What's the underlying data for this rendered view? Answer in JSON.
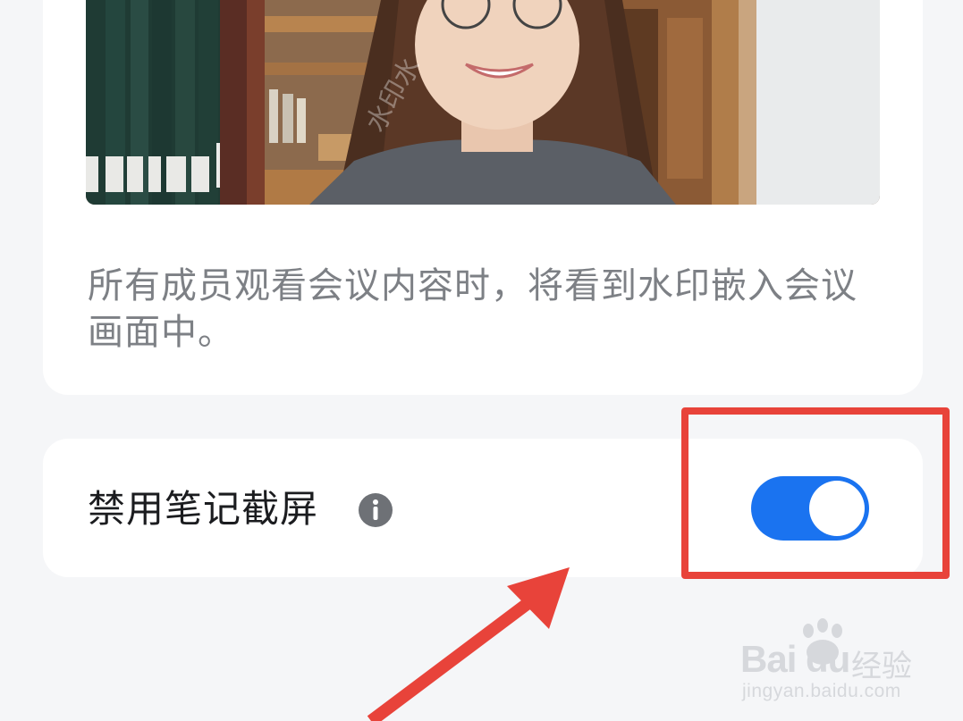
{
  "watermark_section": {
    "description": "所有成员观看会议内容时，将看到水印嵌入会议画面中。",
    "preview_watermark_text": "水印水"
  },
  "screenshot_setting": {
    "label": "禁用笔记截屏",
    "info_icon": "info-circle-icon",
    "toggle_state": "on",
    "toggle_color": "#1a73f0"
  },
  "annotation": {
    "box_color": "#e8433a",
    "arrow_color": "#e8433a"
  },
  "site_watermark": {
    "brand": "Bai  du",
    "suffix": "经验",
    "url": "jingyan.baidu.com"
  }
}
